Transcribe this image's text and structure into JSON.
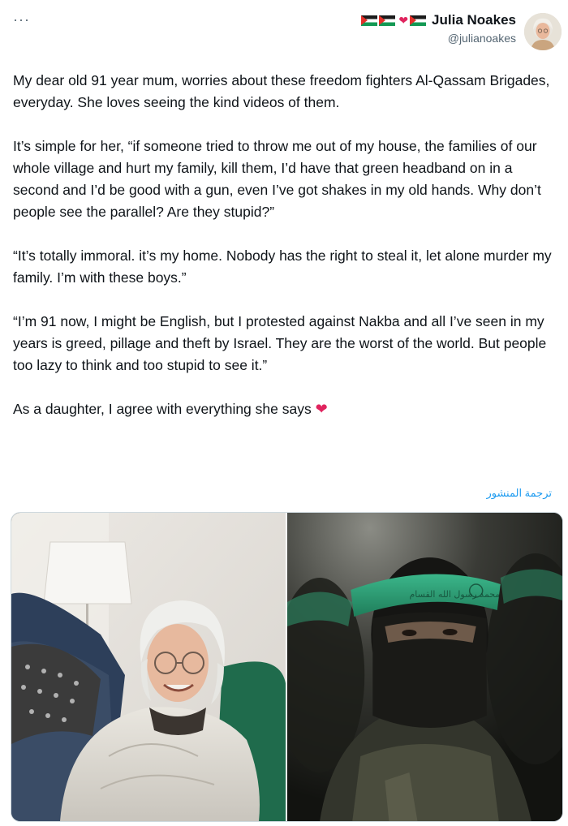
{
  "tweet": {
    "more_label": "···",
    "author": {
      "display_name": "Julia Noakes",
      "handle": "@julianoakes",
      "emojis": [
        "palestine-flag-icon",
        "palestine-flag-icon",
        "red-heart-icon",
        "palestine-flag-icon"
      ]
    },
    "paragraphs": [
      "My dear old 91 year mum, worries about these freedom fighters Al-Qassam Brigades, everyday. She loves seeing the kind videos of them.",
      "It’s simple for her, “if someone tried to throw me out of my house, the families of  our whole village  and hurt my family, kill them, I’d have that green headband on in a second and I’d be good with a gun, even I’ve got shakes in my old hands. Why don’t people see the parallel? Are they stupid?”",
      "“It’s totally immoral. it’s my home. Nobody has the right to steal it, let alone murder my family. I’m with these boys.”",
      "“I’m 91 now, I might be English, but I protested  against Nakba and all I’ve seen in my years is greed, pillage and theft by Israel. They are the worst of the world. But people too lazy to think and too stupid to see it.”",
      "As a daughter, I agree with everything she says"
    ],
    "translate_label": "ترجمة المنشور",
    "headband_text": "محمد رسول الله القسام"
  },
  "colors": {
    "text": "#0f1419",
    "secondary": "#536471",
    "link": "#1d9bf0",
    "heart": "#e0245e",
    "headband_green": "#2fa37a"
  }
}
